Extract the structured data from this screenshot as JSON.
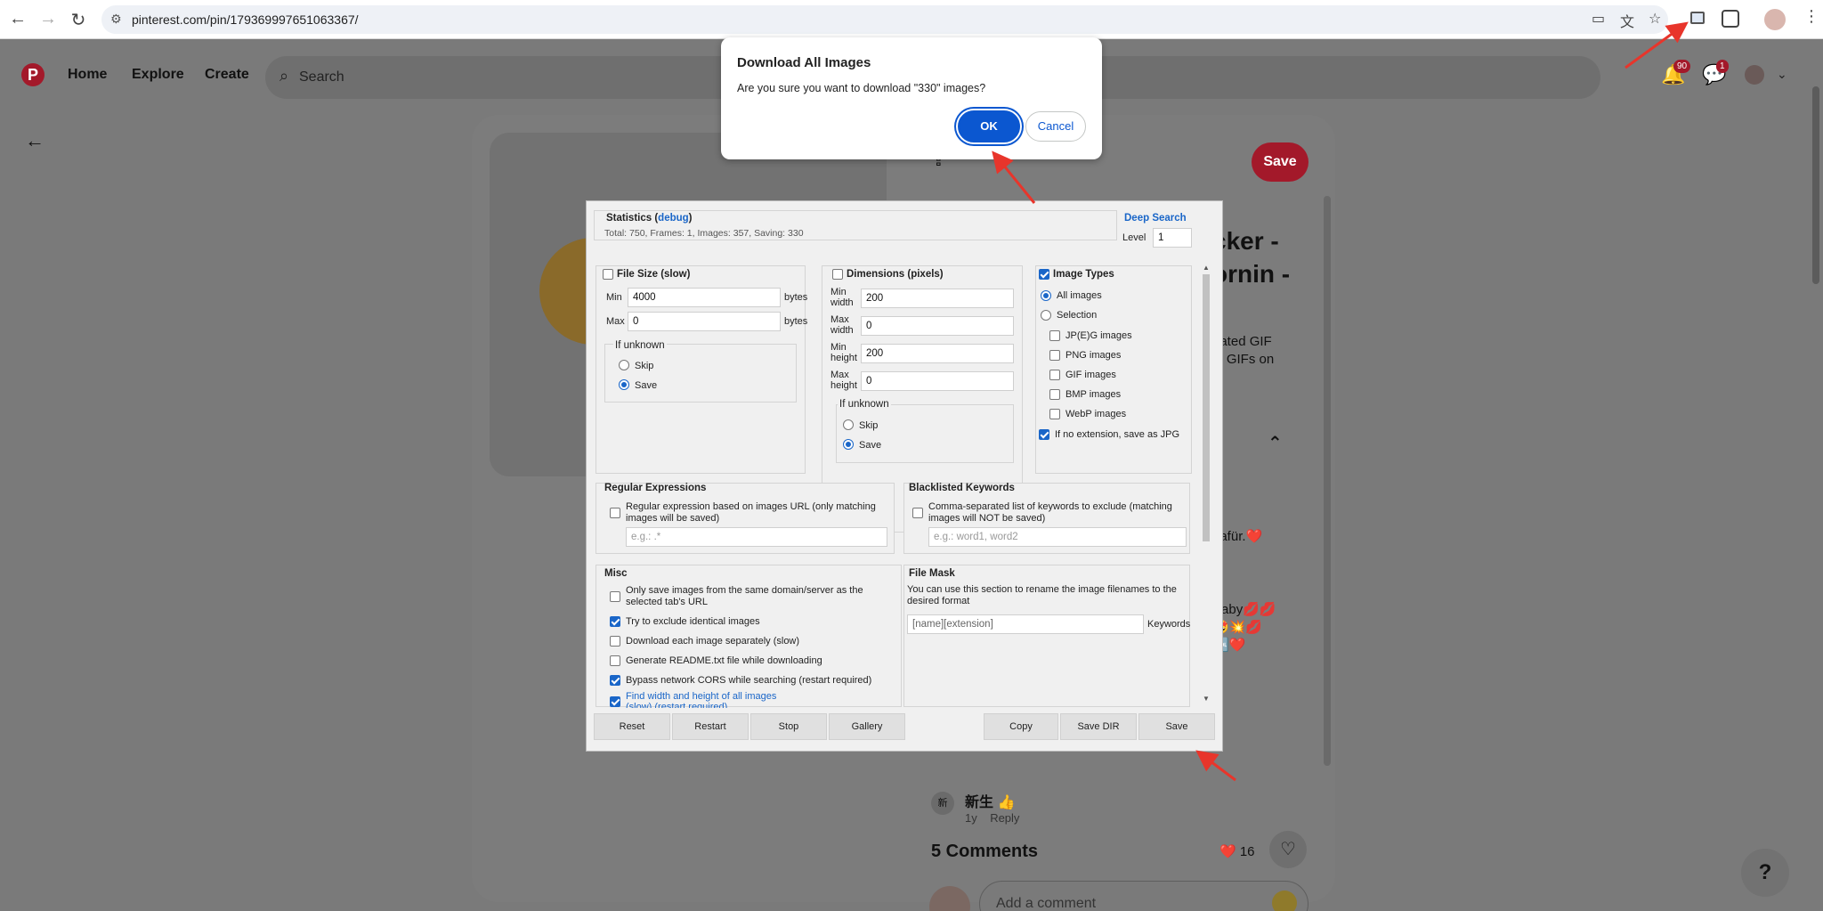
{
  "browser": {
    "url": "pinterest.com/pin/179369997651063367/"
  },
  "pinterest": {
    "logo": "P",
    "nav": [
      "Home",
      "Explore",
      "Create"
    ],
    "search_placeholder": "Search",
    "notif_count": "90",
    "msg_count": "1",
    "save_label": "Save",
    "title_line1": "cker -",
    "title_line2": "ornin -",
    "desc_line1": "nated GIF",
    "desc_line2": "st GIFs on",
    "snippet1": "dafür.❤️",
    "snippet2": "Baby💋💋",
    "snippet3": "🤩💥💋",
    "snippet4": "🆒❤️",
    "comment_avatar_text": "新",
    "comment_name": "新生 👍",
    "comment_age": "1y",
    "comment_reply": "Reply",
    "comments_title": "5 Comments",
    "heart_count": "❤️ 16",
    "add_comment_placeholder": "Add a comment",
    "help": "?"
  },
  "confirm": {
    "title": "Download All Images",
    "message": "Are you sure you want to download \"330\" images?",
    "ok": "OK",
    "cancel": "Cancel"
  },
  "extension": {
    "statistics_title": "Statistics (",
    "statistics_link": "debug",
    "statistics_close": ")",
    "statistics_summary": "Total: 750, Frames: 1, Images: 357, Saving: 330",
    "deep_search": "Deep Search",
    "level_label": "Level",
    "level_value": "1",
    "file_size": {
      "title": "File Size (slow)",
      "min_label": "Min",
      "min_value": "4000",
      "min_unit": "bytes",
      "max_label": "Max",
      "max_value": "0",
      "max_unit": "bytes",
      "unknown_title": "If unknown",
      "skip": "Skip",
      "save": "Save"
    },
    "dimensions": {
      "title": "Dimensions (pixels)",
      "min_width_label": "Min width",
      "min_width": "200",
      "max_width_label": "Max width",
      "max_width": "0",
      "min_height_label": "Min height",
      "min_height": "200",
      "max_height_label": "Max height",
      "max_height": "0",
      "unknown_title": "If unknown",
      "skip": "Skip",
      "save": "Save"
    },
    "image_types": {
      "title": "Image Types",
      "all": "All images",
      "selection": "Selection",
      "jpg": "JP(E)G images",
      "png": "PNG images",
      "gif": "GIF images",
      "bmp": "BMP images",
      "webp": "WebP images",
      "no_ext": "If no extension, save as JPG"
    },
    "regex": {
      "title": "Regular Expressions",
      "desc": "Regular expression based on images URL (only matching images will be saved)",
      "placeholder": "e.g.: .*"
    },
    "blacklist": {
      "title": "Blacklisted Keywords",
      "desc": "Comma-separated list of keywords to exclude (matching images will NOT be saved)",
      "placeholder": "e.g.: word1, word2"
    },
    "misc": {
      "title": "Misc",
      "items": [
        "Only save images from the same domain/server as the selected tab's URL",
        "Try to exclude identical images",
        "Download each image separately (slow)",
        "Generate README.txt file while downloading",
        "Bypass network CORS while searching (restart required)",
        "Find width and height of all images"
      ],
      "last_sub": "(slow) (restart required)"
    },
    "file_mask": {
      "title": "File Mask",
      "desc": "You can use this section to rename the image filenames to the desired format",
      "value": "[name][extension]",
      "keywords": "Keywords"
    },
    "buttons": [
      "Reset",
      "Restart",
      "Stop",
      "Gallery",
      "Copy",
      "Save DIR",
      "Save"
    ]
  },
  "colors": {
    "pinterest_red": "#a3192a",
    "chrome_blue": "#0b57d0",
    "arrow_red": "#e8352b",
    "link_blue": "#1a66c8"
  }
}
